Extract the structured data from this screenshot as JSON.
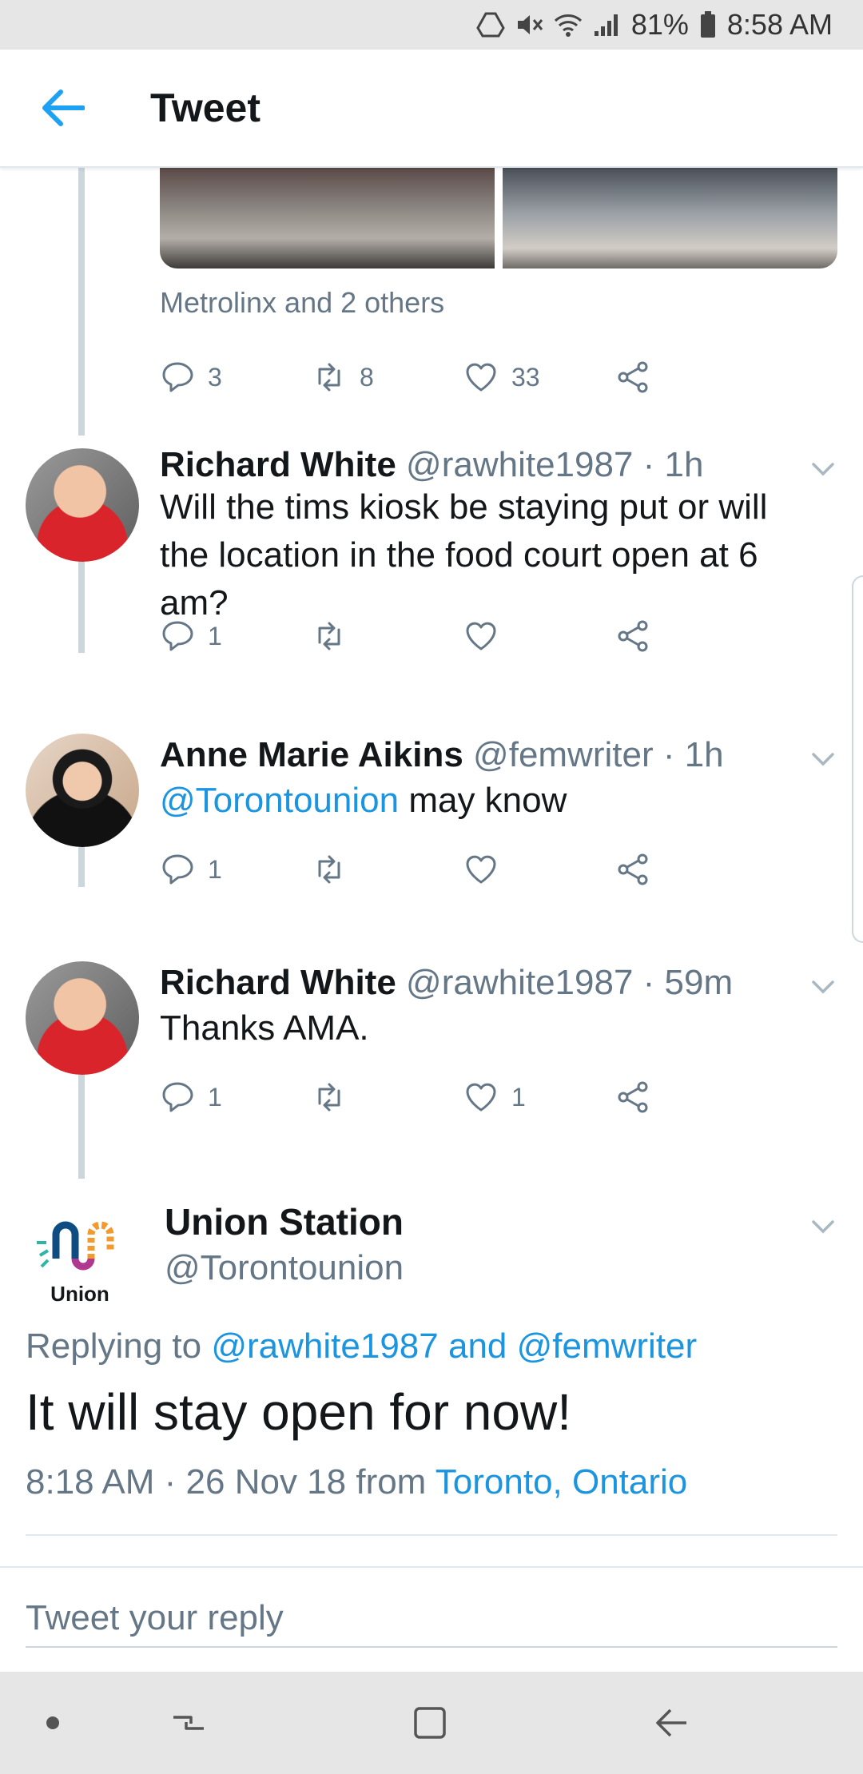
{
  "status_bar": {
    "battery": "81%",
    "time": "8:58 AM"
  },
  "app_bar": {
    "title": "Tweet"
  },
  "previous_tweet": {
    "liked_by": "Metrolinx and 2 others",
    "replies": "3",
    "retweets": "8",
    "likes": "33"
  },
  "replies": [
    {
      "name": "Richard White",
      "handle": "@rawhite1987 · 1h",
      "text": "Will the tims kiosk be staying put or will the location in the food court open at 6 am?",
      "reply_count": "1",
      "retweet_count": "",
      "like_count": ""
    },
    {
      "name": "Anne Marie Aikins",
      "handle": "@femwriter · 1h",
      "mention": "@Torontounion",
      "text": " may know",
      "reply_count": "1",
      "retweet_count": "",
      "like_count": ""
    },
    {
      "name": "Richard White",
      "handle": "@rawhite1987 · 59m",
      "text": "Thanks AMA.",
      "reply_count": "1",
      "retweet_count": "",
      "like_count": "1"
    }
  ],
  "main_tweet": {
    "logo_text": "Union",
    "name": "Union Station",
    "handle": "@Torontounion",
    "replying_prefix": "Replying to ",
    "replying_to": "@rawhite1987 and @femwriter",
    "text": "It will stay open for now!",
    "timestamp": "8:18 AM · 26 Nov 18 from ",
    "location": "Toronto, Ontario"
  },
  "reply_box": {
    "placeholder": "Tweet your reply"
  },
  "colors": {
    "accent": "#1b95e0",
    "muted": "#657786",
    "thread": "#ccd6dd"
  }
}
